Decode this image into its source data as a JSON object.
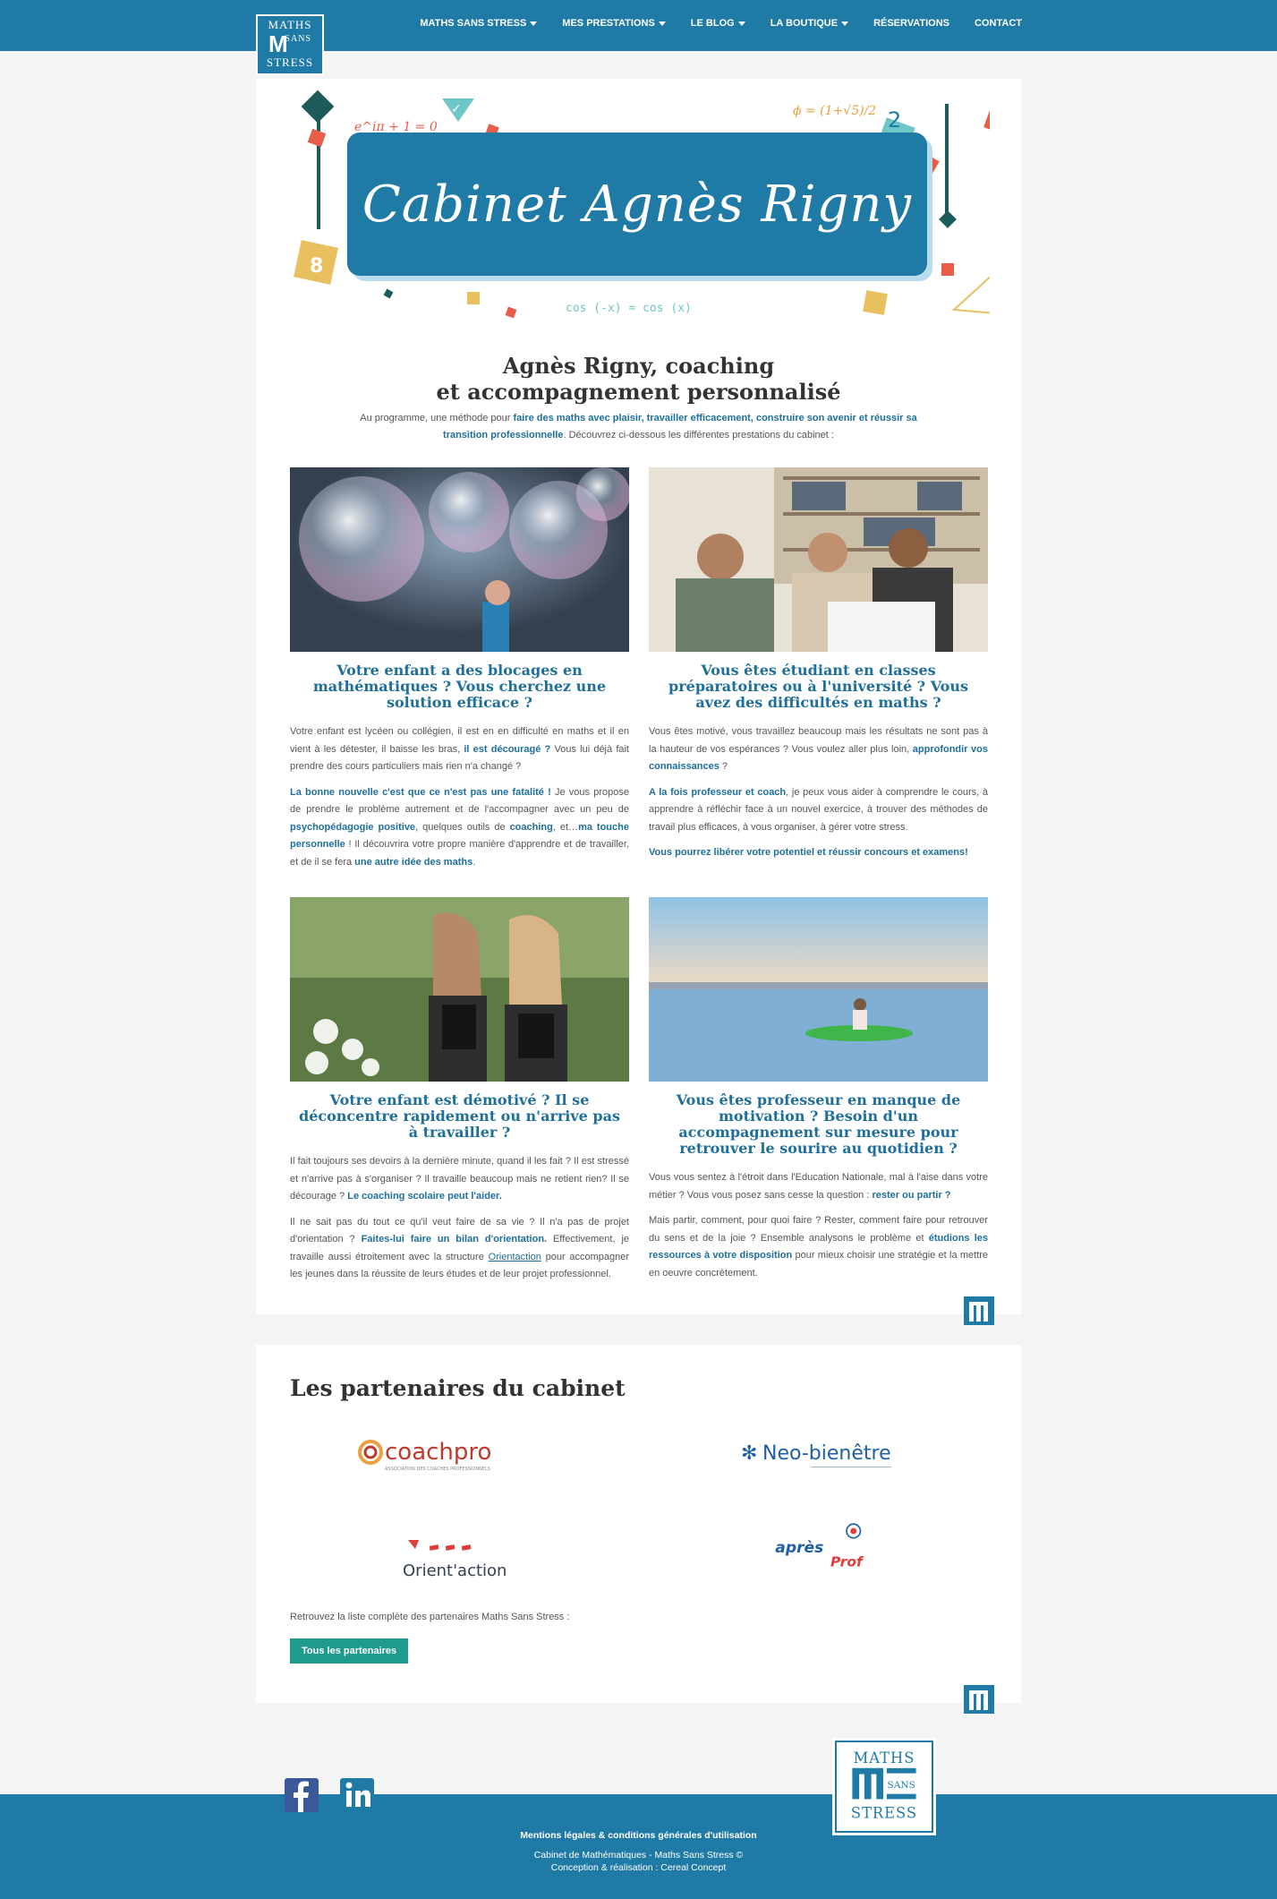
{
  "logo": {
    "line1": "MATHS",
    "m": "M",
    "sans": "SANS",
    "line3": "STRESS"
  },
  "nav": [
    {
      "label": "MATHS SANS STRESS",
      "dropdown": true
    },
    {
      "label": "MES PRESTATIONS",
      "dropdown": true
    },
    {
      "label": "LE BLOG",
      "dropdown": true
    },
    {
      "label": "LA BOUTIQUE",
      "dropdown": true
    },
    {
      "label": "RÉSERVATIONS",
      "dropdown": false
    },
    {
      "label": "CONTACT",
      "dropdown": false
    }
  ],
  "hero": {
    "title": "Cabinet Agnès Rigny",
    "formula1": "e^iπ + 1 = 0",
    "formula2": "ϕ = (1+√5)/2",
    "formula3": "cos (-x) = cos (x)",
    "number8": "8",
    "number2": "2"
  },
  "intro": {
    "title_line1": "Agnès Rigny, coaching",
    "title_line2": "et accompagnement personnalisé",
    "t1": "Au programme, une méthode pour ",
    "l1": "faire des maths avec plaisir, travailler efficacement, construire son avenir et réussir sa transition professionnelle",
    "t2": ". Découvrez ci-dessous les différentes prestations du cabinet :"
  },
  "services": [
    {
      "title": "Votre enfant a des blocages en mathématiques ? Vous cherchez une solution efficace ?",
      "p1_t1": "Votre enfant est lycéen ou collégien, il est en en difficulté en maths et il en vient à les détester, il baisse les bras, ",
      "p1_l1": "il est découragé ?",
      "p1_t2": " Vous lui déjà fait prendre des cours particuliers mais rien n'a changé ?",
      "p2_l1": "La bonne nouvelle c'est que ce n'est pas une fatalité !",
      "p2_t1": " Je vous propose de prendre le problème autrement et de l'accompagner avec un peu de ",
      "p2_l2": "psychopédagogie positive",
      "p2_t2": ", quelques outils de ",
      "p2_l3": "coaching",
      "p2_t3": ", et…",
      "p2_l4": "ma touche personnelle",
      "p2_t4": " ! Il découvrira votre propre manière d'apprendre et de travailler, et de il se fera ",
      "p2_l5": "une autre idée des maths",
      "p2_t5": "."
    },
    {
      "title": "Vous êtes étudiant en classes préparatoires ou à l'université ? Vous avez des difficultés en maths ?",
      "p1_t1": "Vous êtes motivé, vous travaillez beaucoup mais les résultats ne sont pas à la hauteur de vos espérances ? Vous voulez aller plus loin, ",
      "p1_l1": "approfondir vos connaissances",
      "p1_t2": " ?",
      "p2_l1": "A la fois professeur et coach",
      "p2_t1": ", je peux vous aider à comprendre le cours, à apprendre à réfléchir face à un nouvel exercice, à trouver des méthodes de travail plus efficaces, à vous organiser, à gérer votre stress.",
      "p3_l1": "Vous pourrez libérer votre potentiel et réussir  concours et examens!"
    },
    {
      "title": "Votre enfant est démotivé ? Il se déconcentre rapidement ou n'arrive pas à travailler ?",
      "p1_t1": "Il fait toujours ses devoirs à la dernière minute, quand il les fait ? Il est stressé et n'arrive pas à s'organiser ? Il travaille beaucoup mais ne retient rien? Il se décourage ? ",
      "p1_l1": "Le coaching scolaire peut l'aider.",
      "p2_t1": "Il ne sait pas du tout ce qu'il veut faire de sa vie ? Il n'a pas de projet d'orientation ? ",
      "p2_l1": "Faites-lui faire un bilan d'orientation.",
      "p2_t2": " Effectivement, je travaille aussi étroitement avec la structure ",
      "p2_l2": "Orientaction",
      "p2_t3": " pour accompagner les jeunes dans la réussite de leurs études et de leur projet professionnel."
    },
    {
      "title": "Vous êtes professeur en manque de motivation ? Besoin d'un accompagnement sur mesure pour retrouver le sourire au quotidien ?",
      "p1_t1": "Vous vous sentez à l'étroit dans l'Education Nationale, mal à l'aise dans votre métier ? Vous vous posez sans cesse la question : ",
      "p1_l1": "rester ou partir ?",
      "p2_t1": "Mais partir, comment, pour quoi faire ? Rester, comment faire pour retrouver du sens et de la joie ? Ensemble analysons le problème et ",
      "p2_l1": "étudions les ressources à votre disposition",
      "p2_t2": " pour mieux choisir une stratégie et la mettre en oeuvre concrètement."
    }
  ],
  "partners": {
    "title": "Les partenaires du cabinet",
    "coachpro": "coachpro",
    "coachpro_sub": "ASSOCIATION DES COACHES PROFESSIONNELS",
    "neo": "Neo-bienêtre",
    "orient": "Orient'action",
    "apres1": "après",
    "apres2": "Prof",
    "caption": "Retrouvez la liste complète des partenaires Maths Sans Stress :",
    "button": "Tous les partenaires"
  },
  "footer": {
    "legal": "Mentions légales & conditions générales d'utilisation",
    "copyright": "Cabinet de Mathématiques - Maths Sans Stress ©",
    "credit": "Conception & réalisation : Cereal Concept"
  },
  "colors": {
    "primary": "#1f7aa5",
    "link": "#1f6f9a",
    "button": "#1e9b8d"
  }
}
